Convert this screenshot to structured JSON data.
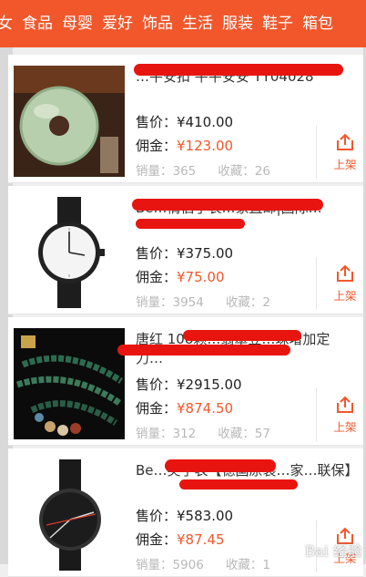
{
  "tabs": [
    "女",
    "食品",
    "母婴",
    "爱好",
    "饰品",
    "生活",
    "服装",
    "鞋子",
    "箱包"
  ],
  "labels": {
    "price": "售价：",
    "commission": "佣金：",
    "sales": "销量：",
    "favorites": "收藏：",
    "share": "上架"
  },
  "products": [
    {
      "title": "…平安扣 平平安安 TY04028",
      "price": "¥410.00",
      "commission": "¥123.00",
      "sales": "365",
      "favorites": "26"
    },
    {
      "title": "Be…情侣手表…家直邮|国际…",
      "price": "¥375.00",
      "commission": "¥75.00",
      "sales": "3954",
      "favorites": "2"
    },
    {
      "title": "唐红 108颗…翡翠豆…珠增加定力…",
      "price": "¥2915.00",
      "commission": "¥874.50",
      "sales": "312",
      "favorites": "57"
    },
    {
      "title": "Be…奖手表【德国原装…家…联保】",
      "price": "¥583.00",
      "commission": "¥87.45",
      "sales": "5906",
      "favorites": "1"
    }
  ],
  "watermark": "Bai 经验"
}
